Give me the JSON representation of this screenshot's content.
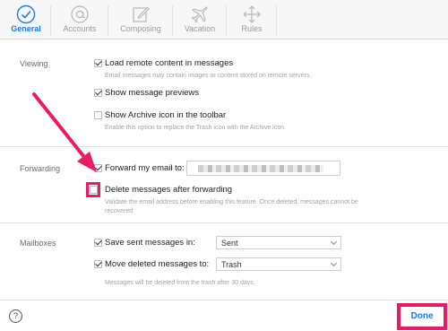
{
  "toolbar": {
    "tabs": [
      {
        "label": "General",
        "icon": "checkmark-circle-icon",
        "active": true
      },
      {
        "label": "Accounts",
        "icon": "at-sign-icon",
        "active": false
      },
      {
        "label": "Composing",
        "icon": "compose-icon",
        "active": false
      },
      {
        "label": "Vacation",
        "icon": "airplane-icon",
        "active": false
      },
      {
        "label": "Rules",
        "icon": "move-arrows-icon",
        "active": false
      }
    ]
  },
  "viewing": {
    "label": "Viewing",
    "load_remote": {
      "label": "Load remote content in messages",
      "checked": true,
      "help": "Email messages may contain images or content stored on remote servers."
    },
    "show_previews": {
      "label": "Show message previews",
      "checked": true
    },
    "show_archive": {
      "label": "Show Archive icon in the toolbar",
      "checked": false,
      "help": "Enable this option to replace the Trash icon with the Archive icon."
    }
  },
  "forwarding": {
    "label": "Forwarding",
    "forward_email": {
      "label": "Forward my email to:",
      "checked": true
    },
    "delete_after": {
      "label": "Delete messages after forwarding",
      "checked": false,
      "help_line1": "Validate the email address before enabling this feature. Once deleted, messages cannot be",
      "help_line2": "recovered."
    }
  },
  "mailboxes": {
    "label": "Mailboxes",
    "save_sent": {
      "label": "Save sent messages in:",
      "checked": true,
      "value": "Sent"
    },
    "move_deleted": {
      "label": "Move deleted messages to:",
      "checked": true,
      "value": "Trash"
    },
    "help": "Messages will be deleted from the trash after 30 days."
  },
  "footer": {
    "help_glyph": "?",
    "done_label": "Done"
  },
  "colors": {
    "accent": "#1a7ee8",
    "annotation": "#ea1a63"
  }
}
